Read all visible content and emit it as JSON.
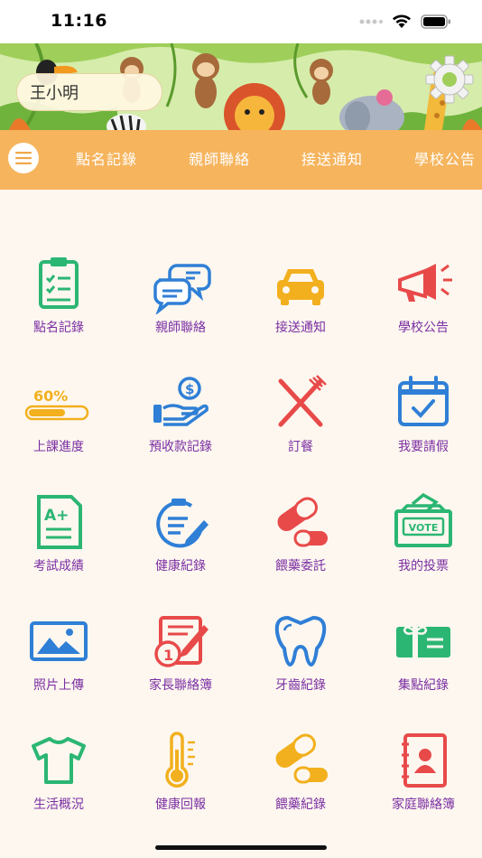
{
  "status": {
    "time": "11:16"
  },
  "header": {
    "student_name": "王小明"
  },
  "nav": {
    "items": [
      "點名記錄",
      "親師聯絡",
      "接送通知",
      "學校公告"
    ]
  },
  "grid": {
    "items": [
      {
        "label": "點名記錄",
        "icon": "clipboard-checklist-icon",
        "color": "#2bb673"
      },
      {
        "label": "親師聯絡",
        "icon": "chat-bubbles-icon",
        "color": "#2f7fd6"
      },
      {
        "label": "接送通知",
        "icon": "car-icon",
        "color": "#f2b01e"
      },
      {
        "label": "學校公告",
        "icon": "megaphone-icon",
        "color": "#e84a4a"
      },
      {
        "label": "上課進度",
        "icon": "progress-bar-icon",
        "color": "#f2b01e",
        "badge": "60%"
      },
      {
        "label": "預收款記錄",
        "icon": "money-hand-icon",
        "color": "#2f7fd6"
      },
      {
        "label": "訂餐",
        "icon": "fork-knife-icon",
        "color": "#e84a4a"
      },
      {
        "label": "我要請假",
        "icon": "calendar-check-icon",
        "color": "#2f7fd6"
      },
      {
        "label": "考試成績",
        "icon": "exam-aplus-icon",
        "color": "#2bb673",
        "badge": "A+"
      },
      {
        "label": "健康紀錄",
        "icon": "clipboard-pen-icon",
        "color": "#2f7fd6"
      },
      {
        "label": "餵藥委託",
        "icon": "capsule-pill-icon",
        "color": "#e84a4a"
      },
      {
        "label": "我的投票",
        "icon": "ballot-box-icon",
        "color": "#2bb673",
        "badge": "VOTE"
      },
      {
        "label": "照片上傳",
        "icon": "photo-icon",
        "color": "#2f7fd6"
      },
      {
        "label": "家長聯絡簿",
        "icon": "notebook-pen-icon",
        "color": "#e84a4a"
      },
      {
        "label": "牙齒紀錄",
        "icon": "tooth-icon",
        "color": "#2f7fd6"
      },
      {
        "label": "集點紀錄",
        "icon": "gift-card-icon",
        "color": "#2bb673"
      },
      {
        "label": "生活概況",
        "icon": "tshirt-icon",
        "color": "#2bb673"
      },
      {
        "label": "健康回報",
        "icon": "thermometer-icon",
        "color": "#f2b01e"
      },
      {
        "label": "餵藥紀錄",
        "icon": "capsule-icon",
        "color": "#f2b01e"
      },
      {
        "label": "家庭聯絡簿",
        "icon": "contact-book-icon",
        "color": "#e84a4a"
      }
    ]
  }
}
